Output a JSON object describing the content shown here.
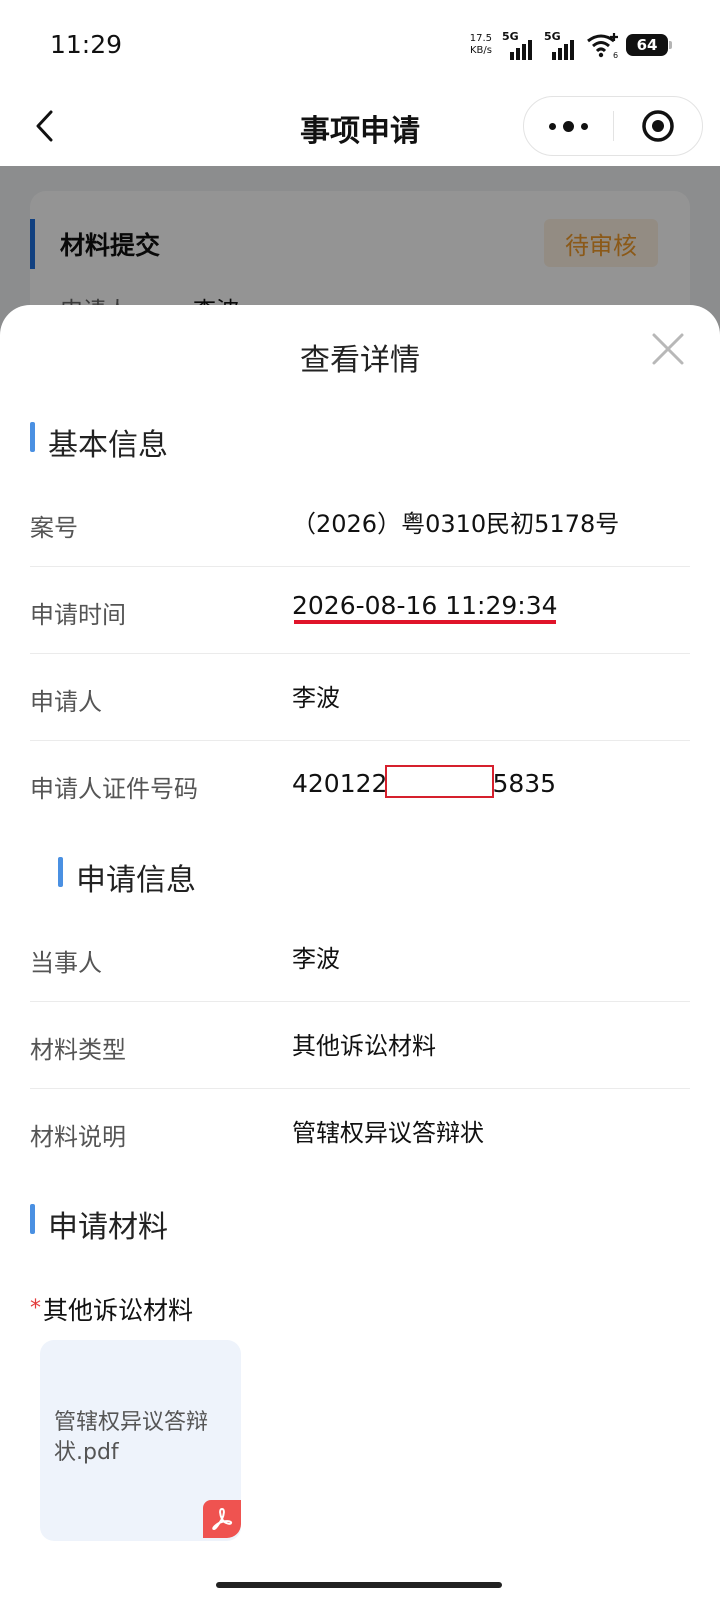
{
  "status_bar": {
    "time": "11:29",
    "net_speed_value": "17.5",
    "net_speed_unit": "KB/s",
    "sim1_label": "5G",
    "sim2_label": "5G",
    "wifi_sub": "6",
    "battery_level": "64"
  },
  "nav": {
    "title": "事项申请"
  },
  "background_card": {
    "title": "材料提交",
    "status_badge": "待审核",
    "applicant_label": "申请人",
    "applicant_value": "李波"
  },
  "sheet": {
    "title": "查看详情",
    "basic_info": {
      "section_title": "基本信息",
      "rows": [
        {
          "label": "案号",
          "value": "（2026）粤0310民初5178号"
        },
        {
          "label": "申请时间",
          "value": "2026-08-16 11:29:34"
        },
        {
          "label": "申请人",
          "value": "李波"
        },
        {
          "label": "申请人证件号码",
          "value_prefix": "420122",
          "value_suffix": "5835"
        }
      ]
    },
    "request_info": {
      "section_title": "申请信息",
      "rows": [
        {
          "label": "当事人",
          "value": "李波"
        },
        {
          "label": "材料类型",
          "value": "其他诉讼材料"
        },
        {
          "label": "材料说明",
          "value": "管辖权异议答辩状"
        }
      ]
    },
    "materials": {
      "section_title": "申请材料",
      "required_mark": "*",
      "category_label": "其他诉讼材料",
      "files": [
        {
          "name": "管辖权异议答辩状.pdf",
          "icon": "pdf-icon"
        }
      ]
    }
  },
  "colors": {
    "accent": "#4a90e2",
    "badge_text": "#f09a2a",
    "highlight_red": "#e0142a"
  }
}
